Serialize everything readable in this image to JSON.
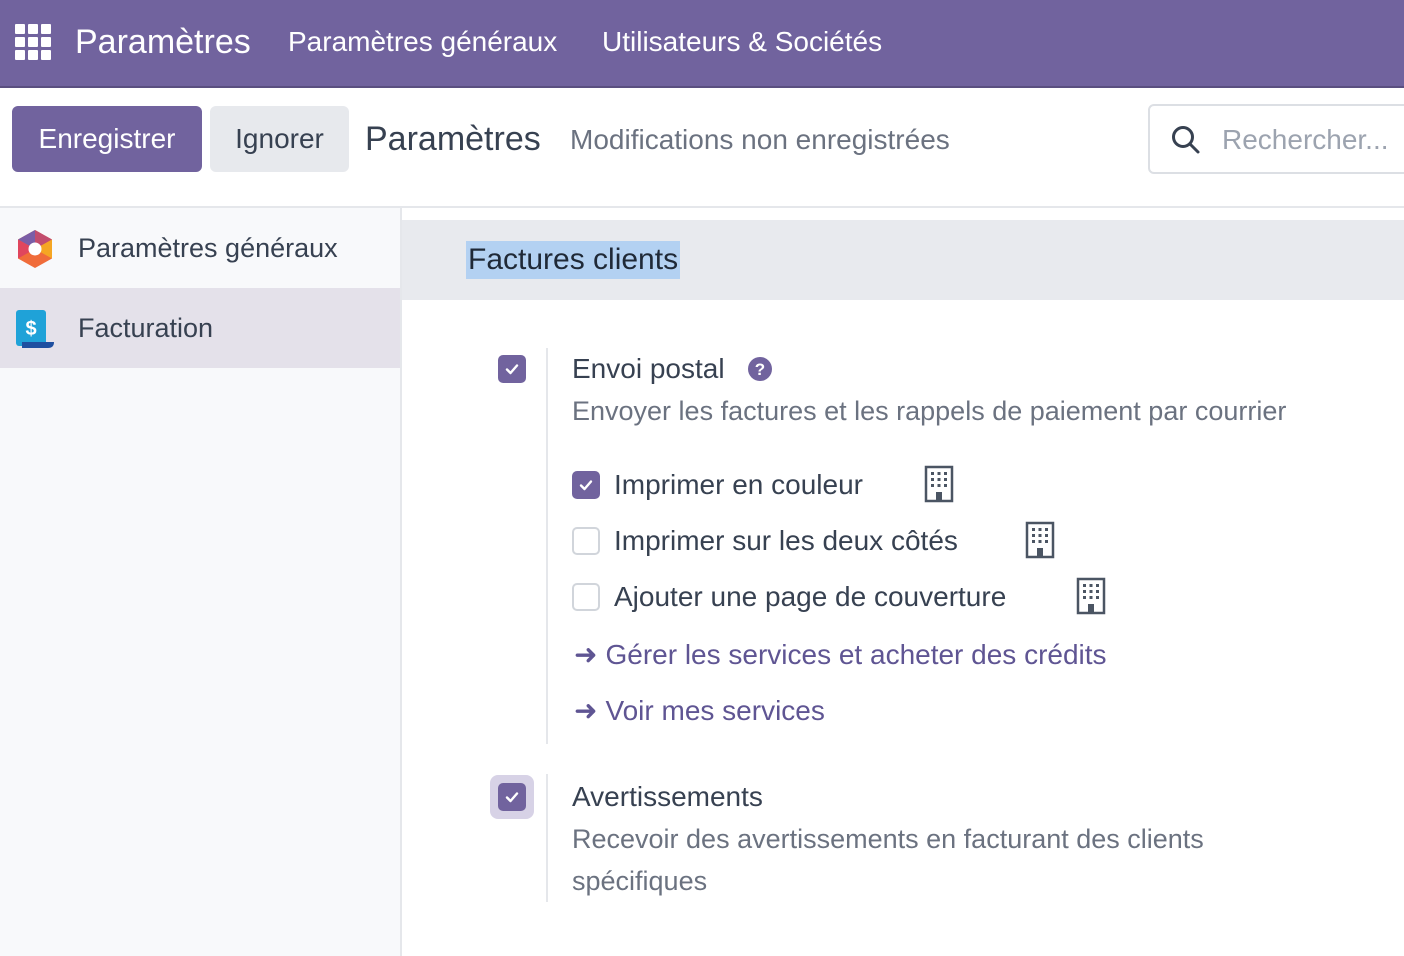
{
  "navbar": {
    "apps_icon": "grid-apps-icon",
    "brand": "Paramètres",
    "links": [
      "Paramètres généraux",
      "Utilisateurs & Sociétés"
    ]
  },
  "control_panel": {
    "save_label": "Enregistrer",
    "discard_label": "Ignorer",
    "title": "Paramètres",
    "status": "Modifications non enregistrées",
    "search": {
      "placeholder": "Rechercher...",
      "value": ""
    }
  },
  "sidebar": {
    "items": [
      {
        "label": "Paramètres généraux",
        "icon": "settings-app-icon",
        "active": false
      },
      {
        "label": "Facturation",
        "icon": "invoicing-app-icon",
        "active": true
      }
    ]
  },
  "section": {
    "title": "Factures clients",
    "settings": [
      {
        "title": "Envoi postal",
        "checked": true,
        "has_help": true,
        "description": "Envoyer les factures et les rappels de paiement par courrier",
        "options": [
          {
            "label": "Imprimer en couleur",
            "checked": true,
            "icon": "company-building-icon"
          },
          {
            "label": "Imprimer sur les deux côtés",
            "checked": false,
            "icon": "company-building-icon"
          },
          {
            "label": "Ajouter une page de couverture",
            "checked": false,
            "icon": "company-building-icon"
          }
        ],
        "links": [
          "Gérer les services et acheter des crédits",
          "Voir mes services"
        ]
      },
      {
        "title": "Avertissements",
        "checked": true,
        "description_lines": [
          "Recevoir des avertissements en facturant des clients",
          "spécifiques"
        ]
      }
    ]
  },
  "colors": {
    "brand": "#71639e",
    "link": "#5f5593",
    "active_sidebar": "#e4e1ea",
    "section_header": "#e8eaee"
  }
}
